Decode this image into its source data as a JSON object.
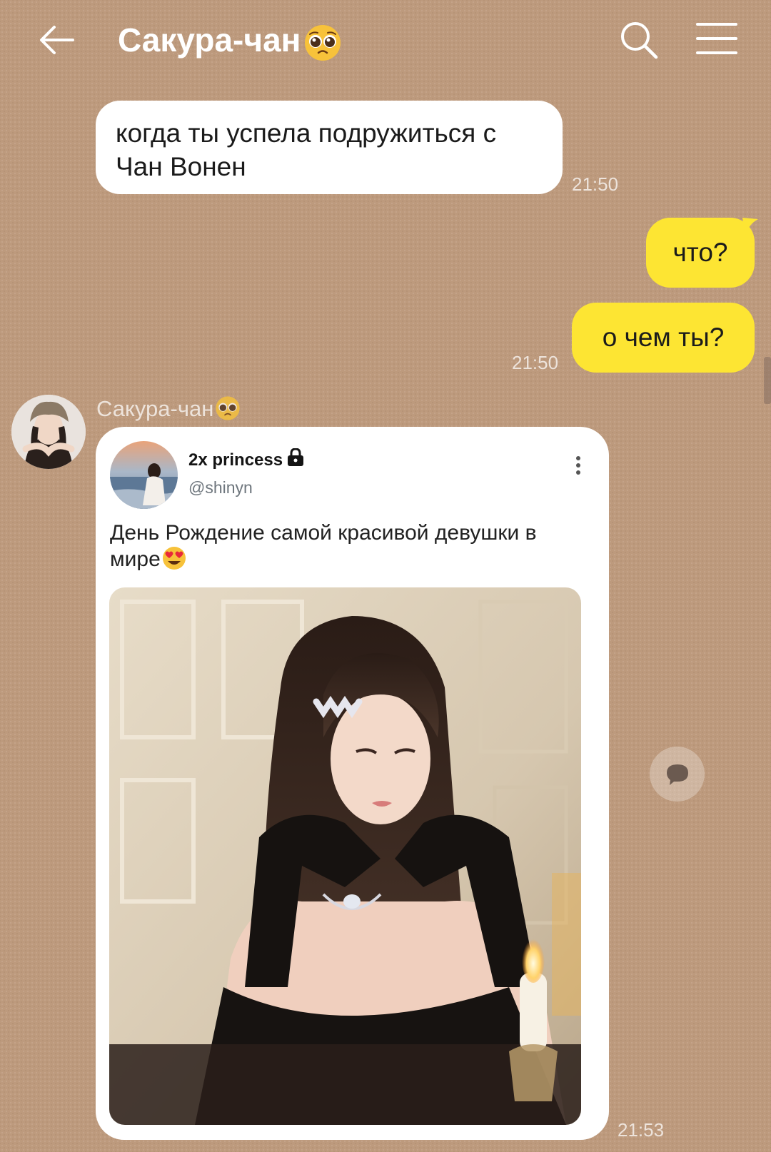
{
  "header": {
    "title": "Сакура-чан",
    "back_icon": "arrow-left-icon",
    "search_icon": "search-icon",
    "menu_icon": "hamburger-menu-icon"
  },
  "messages": [
    {
      "direction": "incoming",
      "text": "когда ты успела подружиться с Чан Вонен",
      "time": "21:50"
    },
    {
      "direction": "outgoing",
      "text": "что?"
    },
    {
      "direction": "outgoing",
      "text": "о чем ты?",
      "time": "21:50"
    }
  ],
  "shared_post_message": {
    "sender": "Сакура-чан",
    "time": "21:53",
    "post": {
      "name": "2x princess",
      "handle": "@shinyn",
      "text": "День Рождение самой красивой девушки в мире"
    }
  },
  "colors": {
    "chat_background": "#bd9a7d",
    "outgoing_bubble": "#fde533",
    "incoming_bubble": "#ffffff"
  }
}
